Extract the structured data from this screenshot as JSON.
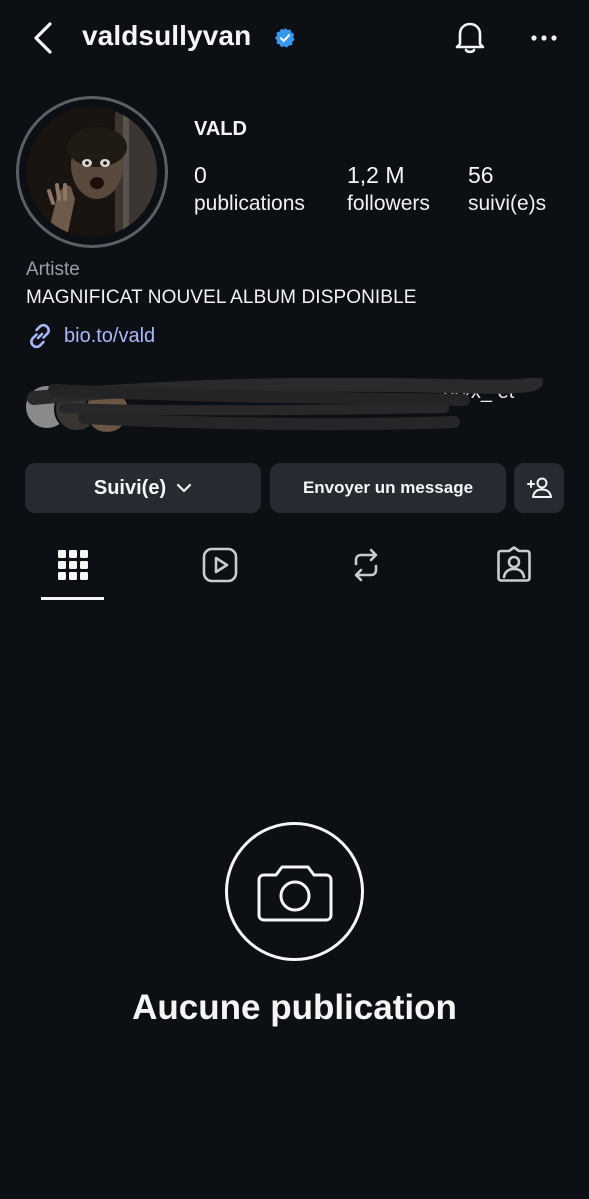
{
  "header": {
    "username": "valdsullyvan",
    "verified_color": "#3897f0"
  },
  "profile": {
    "display_name": "VALD",
    "stats": [
      {
        "value": "0",
        "label": "publications"
      },
      {
        "value": "1,2 M",
        "label": "followers"
      },
      {
        "value": "56",
        "label": "suivi(e)s"
      }
    ],
    "category": "Artiste",
    "bio": "MAGNIFICAT NOUVEL ALBUM DISPONIBLE",
    "link": "bio.to/vald",
    "link_color": "#a8b8f8"
  },
  "followed_by": {
    "visible_text": "_prvx_ et"
  },
  "actions": {
    "follow_label": "Suivi(e)",
    "message_label": "Envoyer un message"
  },
  "tabs": [
    {
      "icon": "grid-icon",
      "active": true
    },
    {
      "icon": "reels-icon",
      "active": false
    },
    {
      "icon": "reposts-icon",
      "active": false
    },
    {
      "icon": "tagged-icon",
      "active": false
    }
  ],
  "empty_state": {
    "icon": "camera-icon",
    "title": "Aucune publication"
  }
}
